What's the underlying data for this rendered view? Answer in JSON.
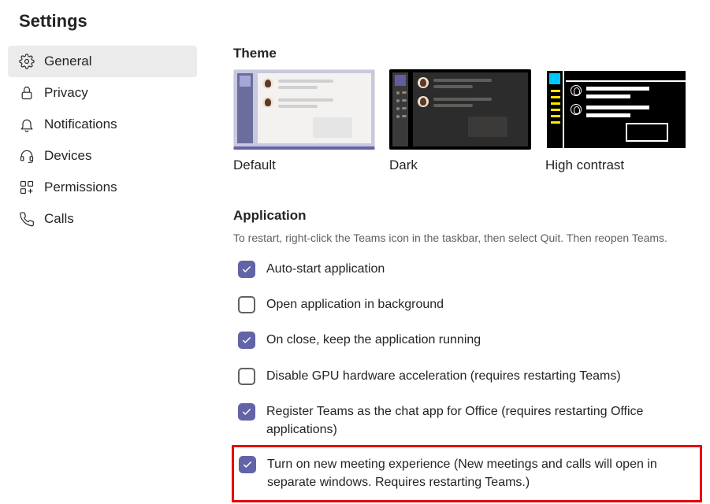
{
  "title": "Settings",
  "sidebar": {
    "items": [
      {
        "id": "general",
        "label": "General",
        "active": true
      },
      {
        "id": "privacy",
        "label": "Privacy",
        "active": false
      },
      {
        "id": "notifications",
        "label": "Notifications",
        "active": false
      },
      {
        "id": "devices",
        "label": "Devices",
        "active": false
      },
      {
        "id": "permissions",
        "label": "Permissions",
        "active": false
      },
      {
        "id": "calls",
        "label": "Calls",
        "active": false
      }
    ]
  },
  "theme": {
    "heading": "Theme",
    "options": [
      {
        "id": "default",
        "label": "Default",
        "selected": true
      },
      {
        "id": "dark",
        "label": "Dark",
        "selected": false
      },
      {
        "id": "high-contrast",
        "label": "High contrast",
        "selected": false
      }
    ]
  },
  "application": {
    "heading": "Application",
    "subtext": "To restart, right-click the Teams icon in the taskbar, then select Quit. Then reopen Teams.",
    "settings": [
      {
        "id": "auto-start",
        "label": "Auto-start application",
        "checked": true
      },
      {
        "id": "open-bg",
        "label": "Open application in background",
        "checked": false
      },
      {
        "id": "keep-running",
        "label": "On close, keep the application running",
        "checked": true
      },
      {
        "id": "disable-gpu",
        "label": "Disable GPU hardware acceleration (requires restarting Teams)",
        "checked": false
      },
      {
        "id": "register-chat",
        "label": "Register Teams as the chat app for Office (requires restarting Office applications)",
        "checked": true
      },
      {
        "id": "new-meeting",
        "label": "Turn on new meeting experience (New meetings and calls will open in separate windows. Requires restarting Teams.)",
        "checked": true,
        "highlighted": true
      }
    ]
  }
}
